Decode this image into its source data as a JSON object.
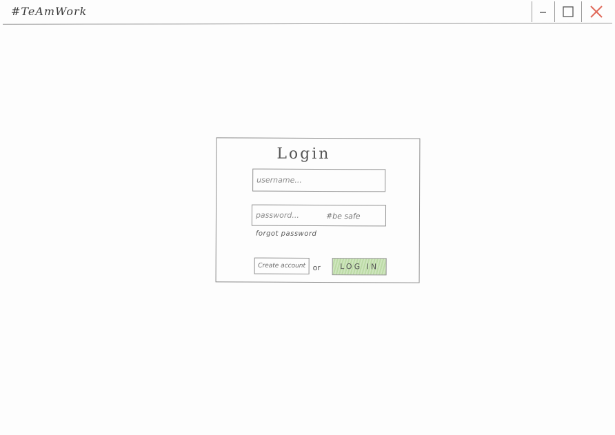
{
  "window": {
    "title": "#TeAmWork",
    "close_color": "#e06a5a"
  },
  "login": {
    "heading": "Login",
    "username_placeholder": "username...",
    "password_placeholder": "password...",
    "password_hint": "#be safe",
    "forgot_label": "forgot password",
    "create_account_label": "Create account",
    "or_label": "or",
    "login_button_label": "LOG IN",
    "login_button_color": "#c5e0b0"
  }
}
